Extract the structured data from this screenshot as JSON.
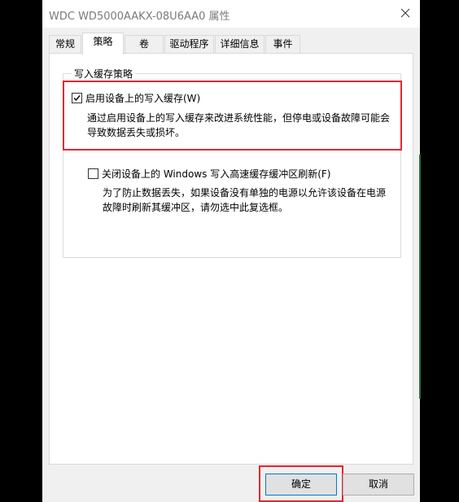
{
  "window": {
    "title": "WDC WD5000AAKX-08U6AA0 属性"
  },
  "tabs": [
    {
      "label": "常规",
      "active": false
    },
    {
      "label": "策略",
      "active": true
    },
    {
      "label": "卷",
      "active": false
    },
    {
      "label": "驱动程序",
      "active": false
    },
    {
      "label": "详细信息",
      "active": false
    },
    {
      "label": "事件",
      "active": false
    }
  ],
  "write_cache": {
    "group_label": "写入缓存策略",
    "enable_option": {
      "label": "启用设备上的写入缓存(W)",
      "checked": true,
      "description_line1": "通过启用设备上的写入缓存来改进系统性能，但停电或设备故障可能会",
      "description_line2": "导致数据丢失或损坏。"
    },
    "flush_option": {
      "label": "关闭设备上的 Windows 写入高速缓存缓冲区刷新(F)",
      "checked": false,
      "description_line1": "为了防止数据丢失，如果设备没有单独的电源以允许该设备在电源",
      "description_line2": "故障时刷新其缓冲区，请勿选中此复选框。"
    }
  },
  "buttons": {
    "ok": "确定",
    "cancel": "取消"
  },
  "colors": {
    "highlight_border": "#e5262f",
    "window_bg": "#f0f0f0",
    "panel_bg": "#ffffff",
    "check_accent": "#000000"
  }
}
